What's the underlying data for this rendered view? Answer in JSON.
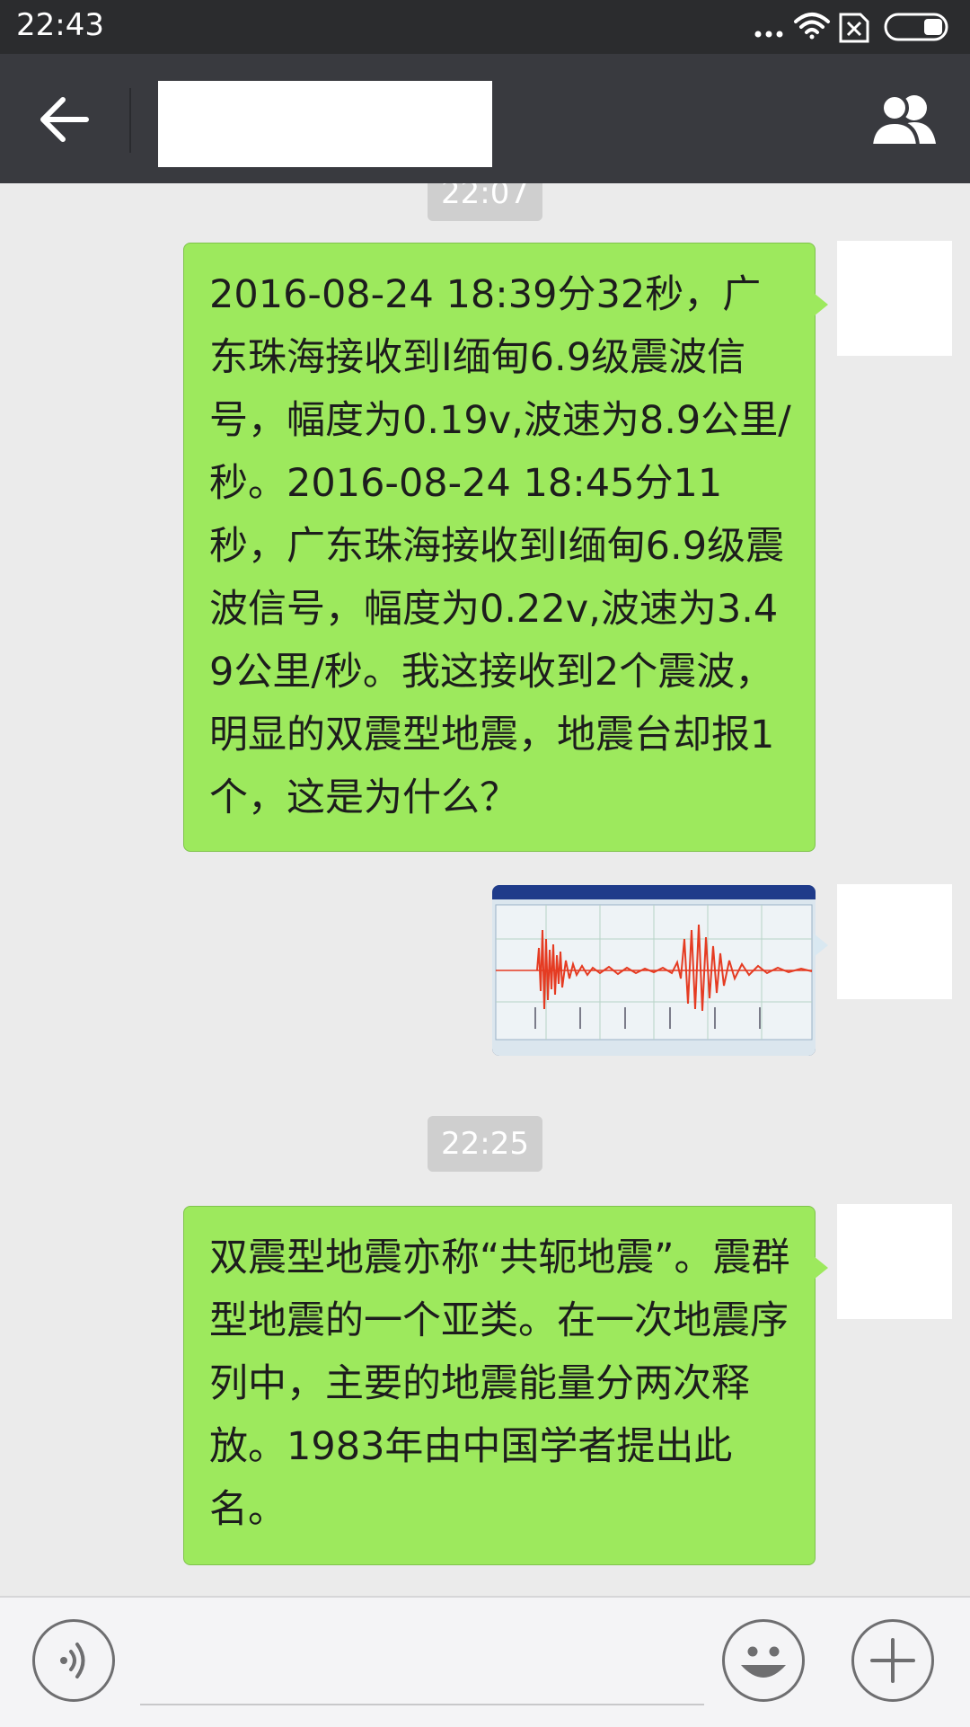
{
  "status_bar": {
    "time": "22:43",
    "icons": [
      "more-dots-icon",
      "wifi-icon",
      "no-sim-icon",
      "battery-icon"
    ]
  },
  "header": {
    "chat_title": "",
    "back_icon": "arrow-left-icon",
    "group_icon": "group-people-icon",
    "background_color": "#393a3f"
  },
  "messages": [
    {
      "type": "timestamp",
      "text": "22:07"
    },
    {
      "type": "text",
      "sender": "self",
      "text": "2016-08-24 18:39分32秒，广东珠海接收到I缅甸6.9级震波信号，幅度为0.19v,波速为8.9公里/秒。2016-08-24 18:45分11秒，广东珠海接收到I缅甸6.9级震波信号，幅度为0.22v,波速为3.49公里/秒。我这接收到2个震波，明显的双震型地震，地震台却报1个，这是为什么？"
    },
    {
      "type": "image",
      "sender": "self",
      "icon": "seismograph-screenshot"
    },
    {
      "type": "timestamp",
      "text": "22:25"
    },
    {
      "type": "text",
      "sender": "self",
      "text": "双震型地震亦称“共轭地震”。震群型地震的一个亚类。在一次地震序列中，主要的地震能量分两次释放。1983年由中国学者提出此名。"
    }
  ],
  "input_bar": {
    "placeholder": "",
    "voice_icon": "voice-icon",
    "emoji_icon": "emoji-icon",
    "plus_icon": "plus-icon"
  },
  "colors": {
    "bubble": "#9de95d",
    "chat_background": "#ebebeb",
    "timestamp_chip": "#cfcfcf"
  }
}
